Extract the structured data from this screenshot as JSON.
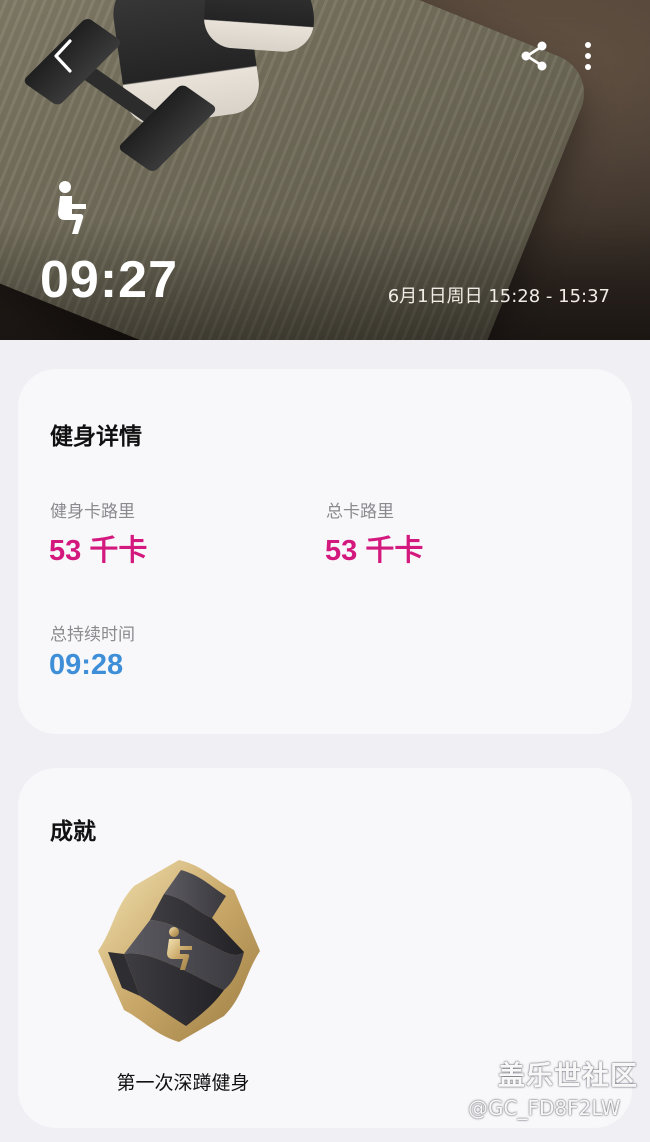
{
  "hero": {
    "duration": "09:27",
    "date_range": "6月1日周日 15:28 - 15:37",
    "icons": {
      "back": "back-arrow-icon",
      "share": "share-icon",
      "more": "more-vertical-icon",
      "workout": "squat-icon"
    }
  },
  "details": {
    "title": "健身详情",
    "workout_calories_label": "健身卡路里",
    "workout_calories_value": "53 千卡",
    "total_calories_label": "总卡路里",
    "total_calories_value": "53 千卡",
    "total_duration_label": "总持续时间",
    "total_duration_value": "09:28"
  },
  "achievements": {
    "title": "成就",
    "badge_label": "第一次深蹲健身",
    "badge_icon": "squat-badge-icon"
  },
  "watermark": {
    "brand": "盖乐世社区",
    "user": "@GC_FD8F2LW"
  },
  "colors": {
    "calories": "#d4197e",
    "duration": "#3f8fd8",
    "page_bg": "#efeff4",
    "card_bg": "#f8f8fb"
  }
}
